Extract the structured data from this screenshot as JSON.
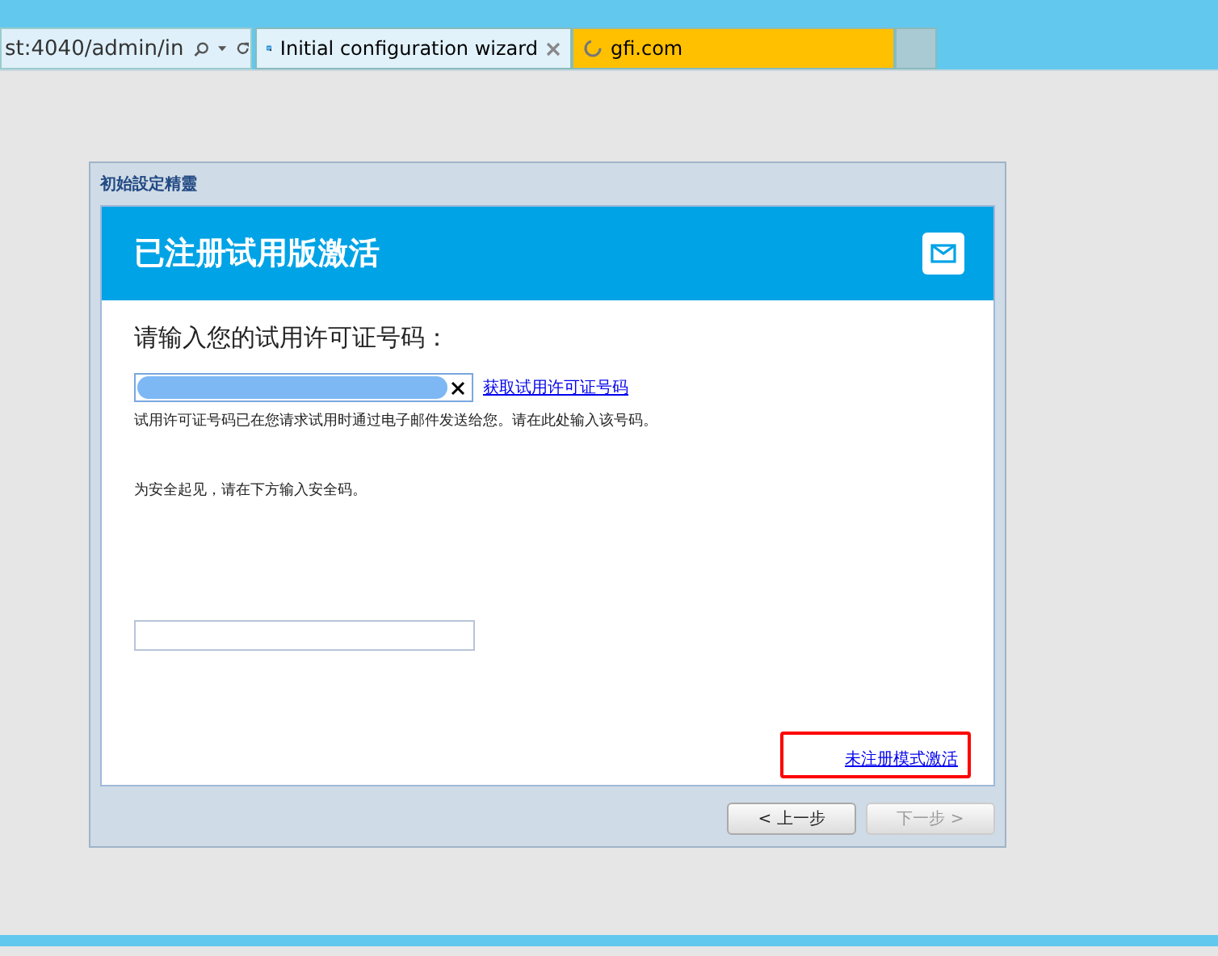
{
  "browser": {
    "address": "st:4040/admin/in",
    "tabs": [
      {
        "label": "Initial configuration wizard",
        "selected": true,
        "loading": false
      },
      {
        "label": "gfi.com",
        "selected": false,
        "loading": true
      }
    ]
  },
  "dialog": {
    "title": "初始設定精靈",
    "header": "已注册试用版激活",
    "prompt": "请输入您的试用许可证号码：",
    "license_link": "获取试用许可证号码",
    "hint": "试用许可证号码已在您请求试用时通过电子邮件发送给您。请在此处输入该号码。",
    "security_text": "为安全起见，请在下方输入安全码。",
    "unregistered_link": "未注册模式激活",
    "buttons": [
      {
        "label": "< 上一步",
        "disabled": false
      },
      {
        "label": "下一步 >",
        "disabled": true
      }
    ]
  }
}
